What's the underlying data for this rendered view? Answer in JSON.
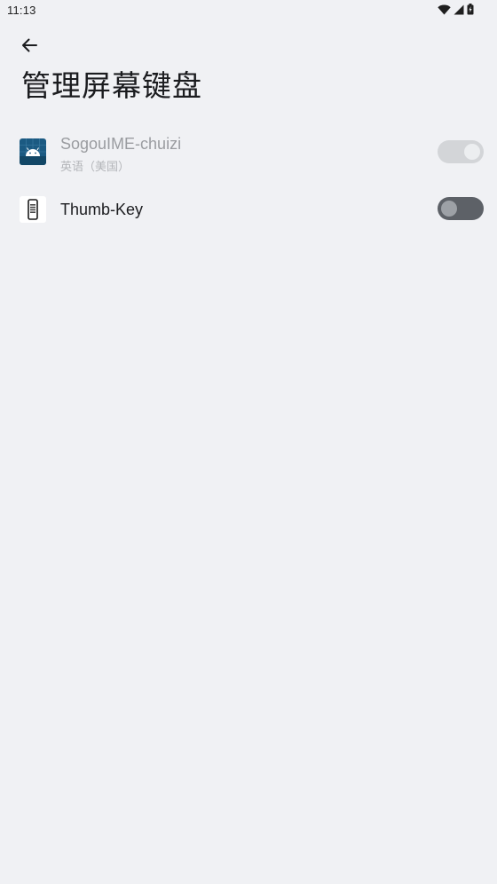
{
  "status_bar": {
    "time": "11:13"
  },
  "header": {
    "title": "管理屏幕键盘"
  },
  "keyboards": [
    {
      "name": "SogouIME-chuizi",
      "subtitle": "英语（美国）",
      "enabled": true,
      "locked": true,
      "icon": "android-icon"
    },
    {
      "name": "Thumb-Key",
      "subtitle": "",
      "enabled": false,
      "locked": false,
      "icon": "keypad-phone-icon"
    }
  ],
  "colors": {
    "background": "#f0f1f4",
    "toggle_on_disabled": "#d3d5d8",
    "toggle_off": "#5d6167",
    "sogou_icon_bg": "#1b5a82"
  }
}
